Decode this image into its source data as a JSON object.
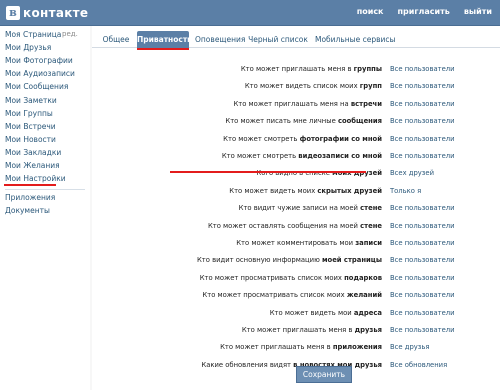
{
  "logo": {
    "letter": "в",
    "text": "контакте"
  },
  "topnav": [
    "поиск",
    "пригласить",
    "выйти"
  ],
  "sidebar": {
    "edit_label": "ред.",
    "items": [
      "Моя Страница",
      "Мои Друзья",
      "Мои Фотографии",
      "Мои Аудиозаписи",
      "Мои Сообщения",
      "Мои Заметки",
      "Мои Группы",
      "Мои Встречи",
      "Мои Новости",
      "Мои Закладки",
      "Мои Желания",
      "Мои Настройки"
    ],
    "extra": [
      "Приложения",
      "Документы"
    ]
  },
  "tabs": [
    "Общее",
    "Приватность",
    "Оповещения",
    "Черный список",
    "Мобильные сервисы"
  ],
  "active_tab": "Приватность",
  "settings": [
    {
      "pre": "Кто может приглашать меня в ",
      "bold": "группы",
      "post": "",
      "value": "Все пользователи"
    },
    {
      "pre": "Кто может видеть список моих ",
      "bold": "групп",
      "post": "",
      "value": "Все пользователи"
    },
    {
      "pre": "Кто может приглашать меня на ",
      "bold": "встречи",
      "post": "",
      "value": "Все пользователи"
    },
    {
      "pre": "Кто может писать мне личные ",
      "bold": "сообщения",
      "post": "",
      "value": "Все пользователи"
    },
    {
      "pre": "Кто может смотреть ",
      "bold": "фотографии со мной",
      "post": "",
      "value": "Все пользователи"
    },
    {
      "pre": "Кто может смотреть ",
      "bold": "видеозаписи со мной",
      "post": "",
      "value": "Все пользователи"
    },
    {
      "pre": "Кого видно в списке ",
      "bold": "моих друзей",
      "post": "",
      "value": "Всех друзей"
    },
    {
      "pre": "Кто может видеть моих ",
      "bold": "скрытых друзей",
      "post": "",
      "value": "Только я"
    },
    {
      "pre": "Кто видит чужие записи на моей ",
      "bold": "стене",
      "post": "",
      "value": "Все пользователи"
    },
    {
      "pre": "Кто может оставлять сообщения на моей ",
      "bold": "стене",
      "post": "",
      "value": "Все пользователи"
    },
    {
      "pre": "Кто может комментировать мои ",
      "bold": "записи",
      "post": "",
      "value": "Все пользователи"
    },
    {
      "pre": "Кто видит основную информацию ",
      "bold": "моей страницы",
      "post": "",
      "value": "Все пользователи"
    },
    {
      "pre": "Кто может просматривать список моих ",
      "bold": "подарков",
      "post": "",
      "value": "Все пользователи"
    },
    {
      "pre": "Кто может просматривать список моих ",
      "bold": "желаний",
      "post": "",
      "value": "Все пользователи"
    },
    {
      "pre": "Кто может видеть мои ",
      "bold": "адреса",
      "post": "",
      "value": "Все пользователи"
    },
    {
      "pre": "Кто может приглашать меня в ",
      "bold": "друзья",
      "post": "",
      "value": "Все пользователи"
    },
    {
      "pre": "Кто может приглашать меня в ",
      "bold": "приложения",
      "post": "",
      "value": "Все друзья"
    },
    {
      "pre": "Какие обновления видят ",
      "bold": "в новостях мои друзья",
      "post": "",
      "value": "Все обновления"
    }
  ],
  "save_label": "Сохранить",
  "colors": {
    "header": "#5b7fa6",
    "link": "#2b587a",
    "highlight": "#e31c1c"
  }
}
